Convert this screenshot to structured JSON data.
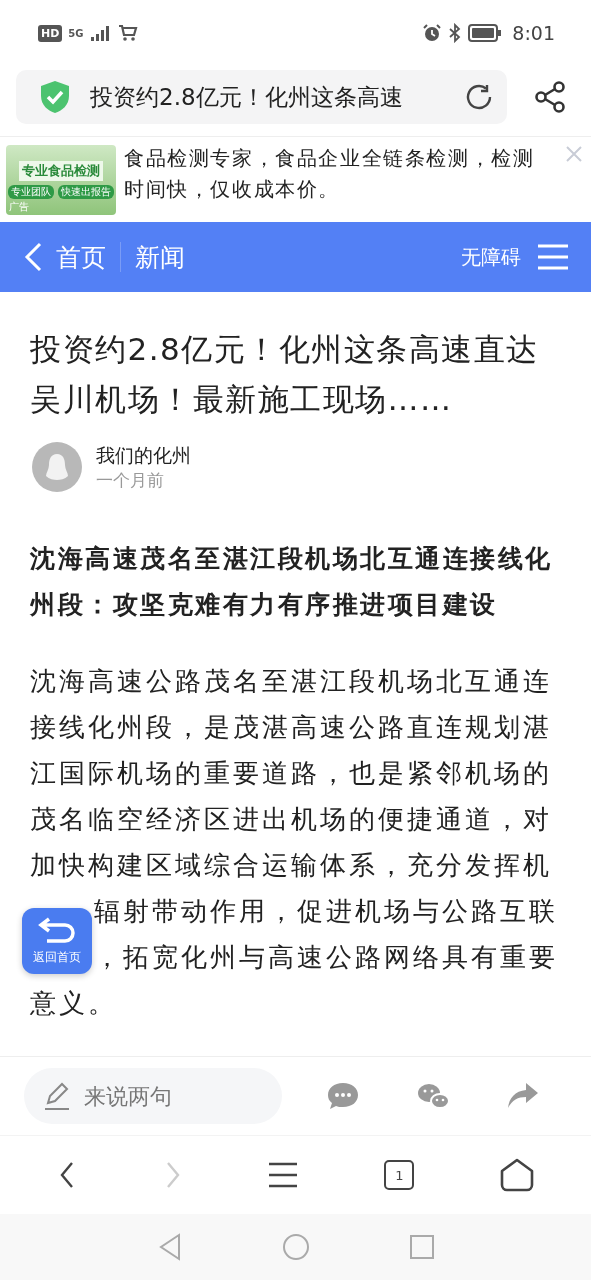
{
  "status_bar": {
    "hd": "HD",
    "network": "5G",
    "time": "8:01"
  },
  "address_bar": {
    "title": "投资约2.8亿元！化州这条高速"
  },
  "ad": {
    "image_title": "专业食品检测",
    "image_tags": [
      "专业团队",
      "快速出报告"
    ],
    "label": "广告",
    "text": "食品检测专家，食品企业全链条检测，检测时间快，仅收成本价。"
  },
  "nav": {
    "back": "首页",
    "section": "新闻",
    "accessibility": "无障碍"
  },
  "article": {
    "title": "投资约2.8亿元！化州这条高速直达吴川机场！最新施工现场……",
    "author": "我们的化州",
    "time": "一个月前",
    "subheading": "沈海高速茂名至湛江段机场北互通连接线化州段：攻坚克难有力有序推进项目建设",
    "paragraph_lines": [
      {
        "kind": "full",
        "text": "沈海高速公路茂名至湛江段机场北互通连"
      },
      {
        "kind": "full",
        "text": "接线化州段，是茂湛高速公路直连规划湛"
      },
      {
        "kind": "full",
        "text": "江国际机场的重要道路，也是紧邻机场的"
      },
      {
        "kind": "full",
        "text": "茂名临空经济区进出机场的便捷通道，对"
      },
      {
        "kind": "full",
        "text": "加快构建区域综合运输体系，充分发挥机"
      },
      {
        "kind": "beside_button",
        "text": "辐射带动作用，促进机场与公路互联"
      },
      {
        "kind": "beside_button",
        "text": "，拓宽化州与高速公路网络具有重要"
      },
      {
        "kind": "full",
        "text": "意义。"
      }
    ]
  },
  "float_button": {
    "label": "返回首页"
  },
  "comment_bar": {
    "placeholder": "来说两句"
  },
  "browser_bar": {
    "forward_disabled": true,
    "tab_count": "1"
  }
}
